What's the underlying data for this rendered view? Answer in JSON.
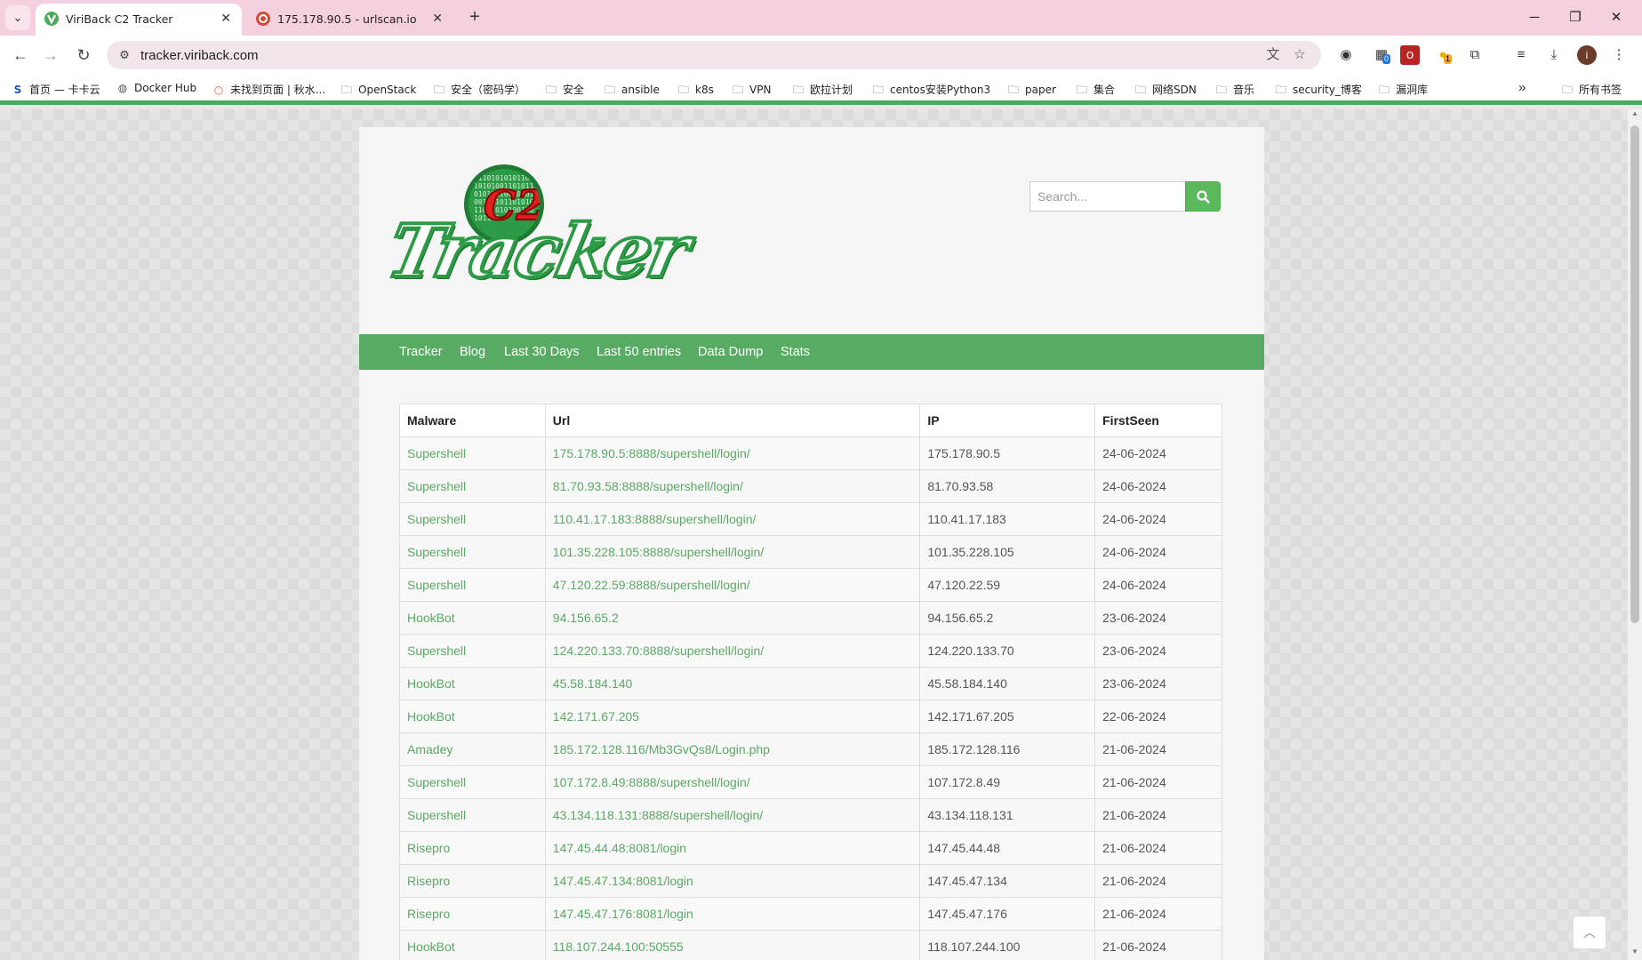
{
  "browser": {
    "tabs": [
      {
        "title": "ViriBack C2 Tracker",
        "favicon": "viriback-v-icon",
        "favicon_color": "#4caa5a"
      },
      {
        "title": "175.178.90.5 - urlscan.io",
        "favicon": "urlscan-icon",
        "favicon_color": "#d14b3c"
      }
    ],
    "url": "tracker.viriback.com",
    "theme_color": "#f3cfe0"
  },
  "bookmarks": [
    {
      "label": "首页 — 卡卡云",
      "icon": "s-logo-icon"
    },
    {
      "label": "Docker Hub",
      "icon": "docker-icon"
    },
    {
      "label": "未找到页面 | 秋水...",
      "icon": "circle-icon"
    },
    {
      "label": "OpenStack",
      "icon": "folder-icon"
    },
    {
      "label": "安全（密码学）",
      "icon": "folder-icon"
    },
    {
      "label": "安全",
      "icon": "folder-icon"
    },
    {
      "label": "ansible",
      "icon": "folder-icon"
    },
    {
      "label": "k8s",
      "icon": "folder-icon"
    },
    {
      "label": "VPN",
      "icon": "folder-icon"
    },
    {
      "label": "欧拉计划",
      "icon": "folder-icon"
    },
    {
      "label": "centos安装Python3",
      "icon": "folder-icon"
    },
    {
      "label": "paper",
      "icon": "folder-icon"
    },
    {
      "label": "集合",
      "icon": "folder-icon"
    },
    {
      "label": "网络SDN",
      "icon": "folder-icon"
    },
    {
      "label": "音乐",
      "icon": "folder-icon"
    },
    {
      "label": "security_博客",
      "icon": "folder-icon"
    },
    {
      "label": "漏洞库",
      "icon": "folder-icon"
    }
  ],
  "all_bookmarks_label": "所有书签",
  "extension_badges": {
    "ext2": "0",
    "ext4": "1"
  },
  "profile_initial": "i",
  "site": {
    "logo_text": "Tracker",
    "logo_badge_text": "C2",
    "logo_digits": "0110101010110010101001101011010101100101010011010110101011001010100110101101",
    "brand_color": "#57ab62",
    "search_placeholder": "Search...",
    "nav": [
      "Tracker",
      "Blog",
      "Last 30 Days",
      "Last 50 entries",
      "Data Dump",
      "Stats"
    ],
    "table": {
      "headers": [
        "Malware",
        "Url",
        "IP",
        "FirstSeen"
      ],
      "rows": [
        [
          "Supershell",
          "175.178.90.5:8888/supershell/login/",
          "175.178.90.5",
          "24-06-2024"
        ],
        [
          "Supershell",
          "81.70.93.58:8888/supershell/login/",
          "81.70.93.58",
          "24-06-2024"
        ],
        [
          "Supershell",
          "110.41.17.183:8888/supershell/login/",
          "110.41.17.183",
          "24-06-2024"
        ],
        [
          "Supershell",
          "101.35.228.105:8888/supershell/login/",
          "101.35.228.105",
          "24-06-2024"
        ],
        [
          "Supershell",
          "47.120.22.59:8888/supershell/login/",
          "47.120.22.59",
          "24-06-2024"
        ],
        [
          "HookBot",
          "94.156.65.2",
          "94.156.65.2",
          "23-06-2024"
        ],
        [
          "Supershell",
          "124.220.133.70:8888/supershell/login/",
          "124.220.133.70",
          "23-06-2024"
        ],
        [
          "HookBot",
          "45.58.184.140",
          "45.58.184.140",
          "23-06-2024"
        ],
        [
          "HookBot",
          "142.171.67.205",
          "142.171.67.205",
          "22-06-2024"
        ],
        [
          "Amadey",
          "185.172.128.116/Mb3GvQs8/Login.php",
          "185.172.128.116",
          "21-06-2024"
        ],
        [
          "Supershell",
          "107.172.8.49:8888/supershell/login/",
          "107.172.8.49",
          "21-06-2024"
        ],
        [
          "Supershell",
          "43.134.118.131:8888/supershell/login/",
          "43.134.118.131",
          "21-06-2024"
        ],
        [
          "Risepro",
          "147.45.44.48:8081/login",
          "147.45.44.48",
          "21-06-2024"
        ],
        [
          "Risepro",
          "147.45.47.134:8081/login",
          "147.45.47.134",
          "21-06-2024"
        ],
        [
          "Risepro",
          "147.45.47.176:8081/login",
          "147.45.47.176",
          "21-06-2024"
        ],
        [
          "HookBot",
          "118.107.244.100:50555",
          "118.107.244.100",
          "21-06-2024"
        ]
      ]
    }
  }
}
